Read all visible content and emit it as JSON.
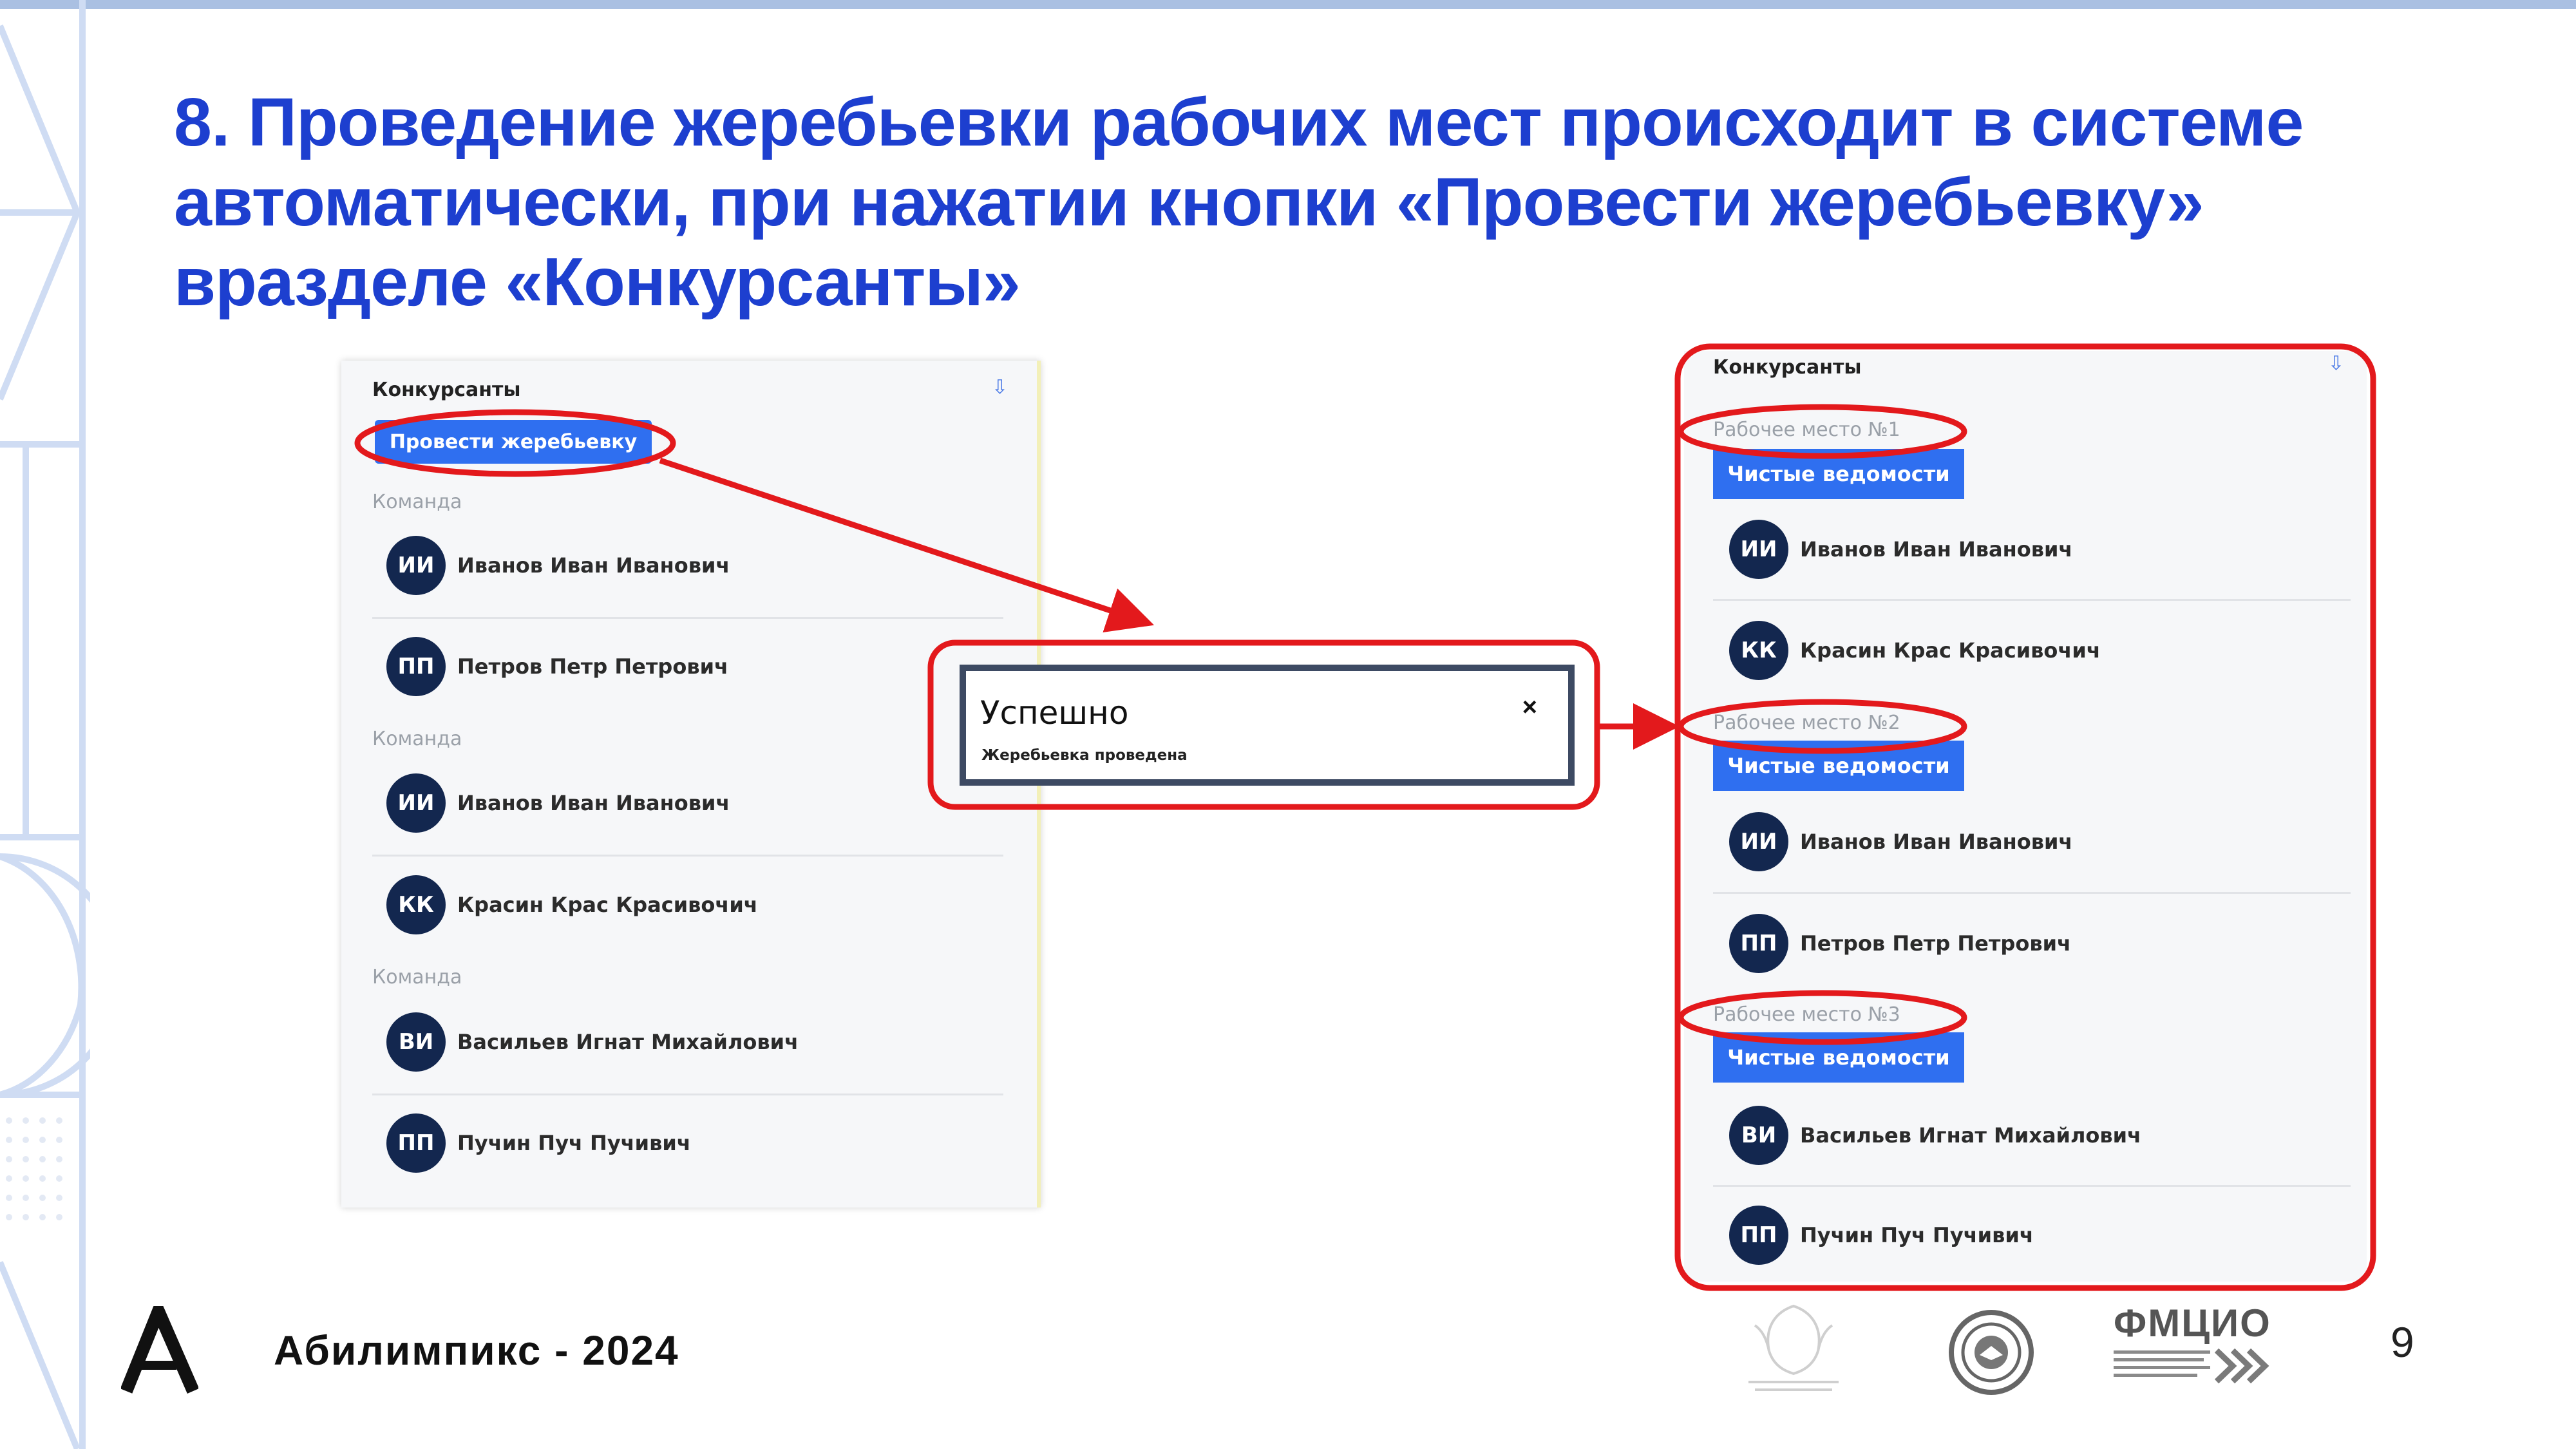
{
  "slide": {
    "title_lines": [
      "8. Проведение жеребьевки  рабочих мест происходит в системе",
      "автоматически, при нажатии кнопки «Провести жеребьевку»",
      "вразделе «Конкурсанты»"
    ],
    "page_number": "9",
    "brand": "Абилимпикс - 2024",
    "partner_logo_text": "ФМЦИО"
  },
  "left_panel": {
    "title": "Конкурсанты",
    "draw_button": "Провести жеребьевку",
    "teams": [
      {
        "label": "Команда",
        "members": [
          {
            "initials": "ИИ",
            "name": "Иванов Иван Иванович"
          },
          {
            "initials": "ПП",
            "name": "Петров Петр Петрович"
          }
        ]
      },
      {
        "label": "Команда",
        "members": [
          {
            "initials": "ИИ",
            "name": "Иванов Иван Иванович"
          },
          {
            "initials": "КК",
            "name": "Красин Крас Красивочич"
          }
        ]
      },
      {
        "label": "Команда",
        "members": [
          {
            "initials": "ВИ",
            "name": "Васильев Игнат Михайлович"
          },
          {
            "initials": "ПП",
            "name": "Пучин Пуч Пучивич"
          }
        ]
      }
    ]
  },
  "toast": {
    "title": "Успешно",
    "message": "Жеребьевка проведена",
    "close": "×"
  },
  "right_panel": {
    "title": "Конкурсанты",
    "workstations": [
      {
        "label": "Рабочее место №1",
        "button": "Чистые ведомости",
        "members": [
          {
            "initials": "ИИ",
            "name": "Иванов Иван Иванович"
          },
          {
            "initials": "КК",
            "name": "Красин Крас Красивочич"
          }
        ]
      },
      {
        "label": "Рабочее место №2",
        "button": "Чистые ведомости",
        "members": [
          {
            "initials": "ИИ",
            "name": "Иванов Иван Иванович"
          },
          {
            "initials": "ПП",
            "name": "Петров Петр Петрович"
          }
        ]
      },
      {
        "label": "Рабочее место №3",
        "button": "Чистые ведомости",
        "members": [
          {
            "initials": "ВИ",
            "name": "Васильев Игнат Михайлович"
          },
          {
            "initials": "ПП",
            "name": "Пучин Пуч Пучивич"
          }
        ]
      }
    ]
  },
  "colors": {
    "title_blue": "#1d3fcf",
    "button_blue": "#2f6ff0",
    "avatar_navy": "#13274f",
    "highlight_red": "#e3191c"
  }
}
